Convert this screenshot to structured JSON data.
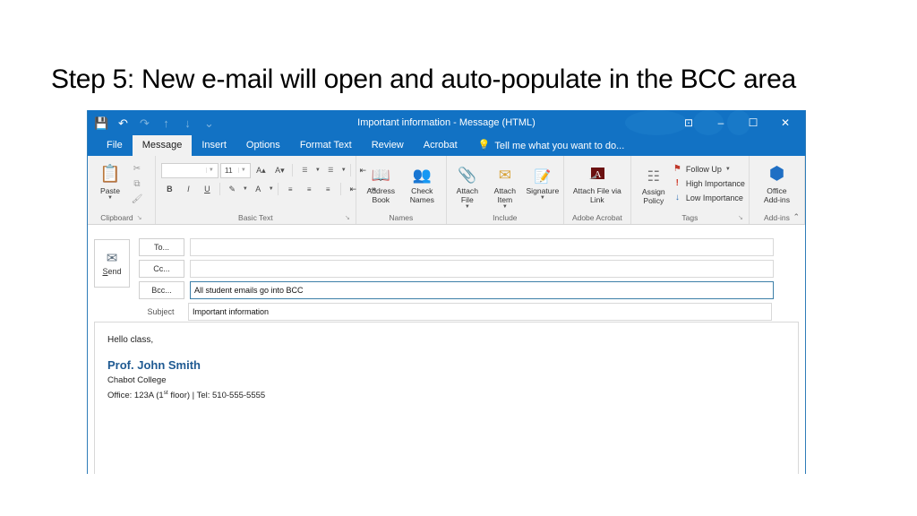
{
  "slide": {
    "title": "Step 5: New e-mail will open and auto-populate in the BCC area"
  },
  "window": {
    "title": "Important information - Message (HTML)",
    "quick_access": [
      {
        "name": "save-icon",
        "glyph": "💾",
        "enabled": true
      },
      {
        "name": "undo-icon",
        "glyph": "↶",
        "enabled": true
      },
      {
        "name": "redo-icon",
        "glyph": "↷",
        "enabled": false
      },
      {
        "name": "previous-item-icon",
        "glyph": "↑",
        "enabled": false
      },
      {
        "name": "next-item-icon",
        "glyph": "↓",
        "enabled": false
      },
      {
        "name": "customize-quick-access-icon",
        "glyph": "⌄",
        "enabled": false
      }
    ],
    "controls": [
      {
        "name": "ribbon-display-options-button",
        "glyph": "⊡"
      },
      {
        "name": "minimize-button",
        "glyph": "–"
      },
      {
        "name": "restore-button",
        "glyph": "☐"
      },
      {
        "name": "close-button",
        "glyph": "✕"
      }
    ]
  },
  "tabs": [
    {
      "label": "File",
      "active": false
    },
    {
      "label": "Message",
      "active": true
    },
    {
      "label": "Insert",
      "active": false
    },
    {
      "label": "Options",
      "active": false
    },
    {
      "label": "Format Text",
      "active": false
    },
    {
      "label": "Review",
      "active": false
    },
    {
      "label": "Acrobat",
      "active": false
    }
  ],
  "tell_me": {
    "icon": "💡",
    "placeholder": "Tell me what you want to do..."
  },
  "ribbon": {
    "clipboard": {
      "group_label": "Clipboard",
      "dialog_launcher": "↘",
      "paste_label": "Paste",
      "paste_icon": "📋",
      "mini_buttons": [
        {
          "name": "cut-icon",
          "glyph": "✂"
        },
        {
          "name": "copy-icon",
          "glyph": "⧉"
        },
        {
          "name": "format-painter-icon",
          "glyph": "🖌"
        }
      ]
    },
    "basic_text": {
      "group_label": "Basic Text",
      "dialog_launcher": "↘",
      "font_name": "",
      "font_size": "11",
      "grow_font": "A▴",
      "shrink_font": "A▾",
      "bullets_icon": "☰",
      "numbering_icon": "☰",
      "decrease_indent_icon": "⇤",
      "bold": "B",
      "italic": "I",
      "underline": "U",
      "highlight_icon": "✎",
      "font_color_icon": "A",
      "align_left_icon": "≡",
      "align_center_icon": "≡",
      "align_right_icon": "≡",
      "indent_less_icon": "⇤",
      "indent_more_icon": "⇥"
    },
    "names": {
      "group_label": "Names",
      "buttons": [
        {
          "label": "Address Book",
          "icon": "📖"
        },
        {
          "label": "Check Names",
          "icon": "👥"
        }
      ]
    },
    "include": {
      "group_label": "Include",
      "buttons": [
        {
          "label": "Attach File",
          "icon": "📎",
          "dropdown": true
        },
        {
          "label": "Attach Item",
          "icon": "✉",
          "dropdown": true
        },
        {
          "label": "Signature",
          "icon": "📝",
          "dropdown": true
        }
      ]
    },
    "adobe_acrobat": {
      "group_label": "Adobe Acrobat",
      "button_label": "Attach File via Link",
      "icon": "🗐"
    },
    "tags": {
      "group_label": "Tags",
      "dialog_launcher": "↘",
      "assign_policy_label": "Assign Policy",
      "assign_policy_icon": "☷",
      "items": [
        {
          "label": "Follow Up",
          "icon": "⚑",
          "color": "#c0392b",
          "dropdown": true
        },
        {
          "label": "High Importance",
          "icon": "!",
          "color": "#d03a2a",
          "dropdown": false
        },
        {
          "label": "Low Importance",
          "icon": "↓",
          "color": "#2e6fb5",
          "dropdown": false
        }
      ]
    },
    "addins": {
      "group_label": "Add-ins",
      "button_label": "Office Add-ins",
      "icon": "⬢"
    },
    "collapse_ribbon_icon": "⌃"
  },
  "message": {
    "send_label": "Send",
    "send_icon": "✉",
    "fields": [
      {
        "name": "to",
        "button_label": "To...",
        "value": "",
        "focused": false,
        "is_button": true
      },
      {
        "name": "cc",
        "button_label": "Cc...",
        "value": "",
        "focused": false,
        "is_button": true
      },
      {
        "name": "bcc",
        "button_label": "Bcc...",
        "value": "All student emails go into BCC",
        "focused": true,
        "is_button": true
      },
      {
        "name": "subject",
        "button_label": "Subject",
        "value": "Important information",
        "focused": false,
        "is_button": false
      }
    ],
    "body": {
      "greeting": "Hello class,",
      "signature_name": "Prof. John Smith",
      "signature_org": "Chabot College",
      "signature_contact_pre": "Office: 123A (1",
      "signature_contact_sup": "st",
      "signature_contact_post": " floor) | Tel: 510-555-5555"
    }
  },
  "colors": {
    "titlebar_blue": "#1272c4",
    "ribbon_gray": "#f1f1f1",
    "accent_blue": "#1f5a92",
    "focus_border": "#3d7fa8",
    "window_border": "#2e7cb8"
  }
}
